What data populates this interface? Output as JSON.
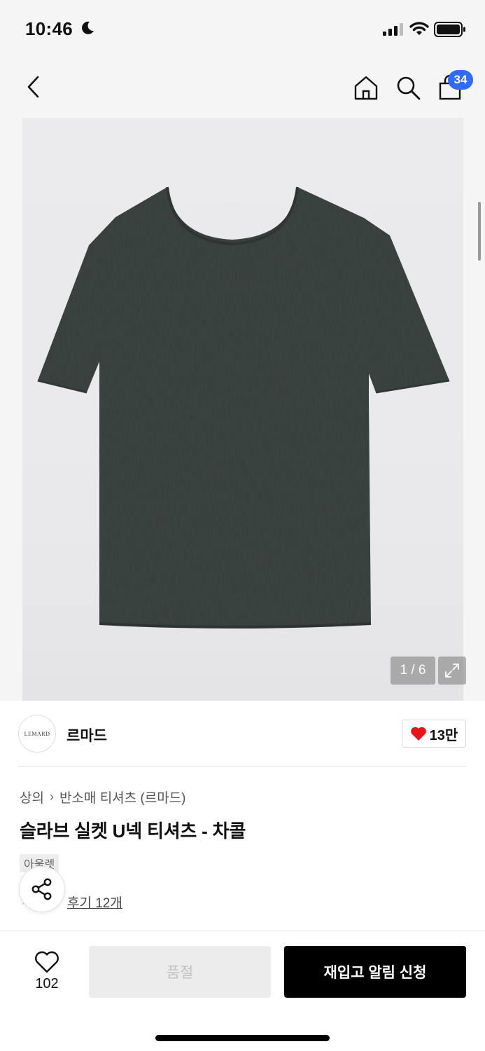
{
  "status_bar": {
    "time": "10:46"
  },
  "nav": {
    "cart_badge": "34"
  },
  "gallery": {
    "counter": "1 / 6"
  },
  "brand": {
    "logo_text": "LEMARD",
    "name": "르마드",
    "like_count": "13만"
  },
  "breadcrumb": {
    "category": "상의",
    "subcategory": "반소매 티셔츠 (르마드)"
  },
  "product": {
    "title": "슬라브 실켓 U넥 티셔츠 - 차콜",
    "tag": "아울렛",
    "review_link": "후기 12개"
  },
  "bottom_bar": {
    "wish_count": "102",
    "soldout_label": "품절",
    "restock_label": "재입고 알림 신청"
  },
  "colors": {
    "accent_blue": "#2f6bff",
    "heart_red": "#e8141c",
    "shirt": "#3f4744"
  },
  "icons": [
    "moon-icon",
    "signal-icon",
    "wifi-icon",
    "battery-icon",
    "back-icon",
    "home-icon",
    "search-icon",
    "cart-icon",
    "expand-icon",
    "heart-icon",
    "share-icon",
    "star-icon"
  ]
}
